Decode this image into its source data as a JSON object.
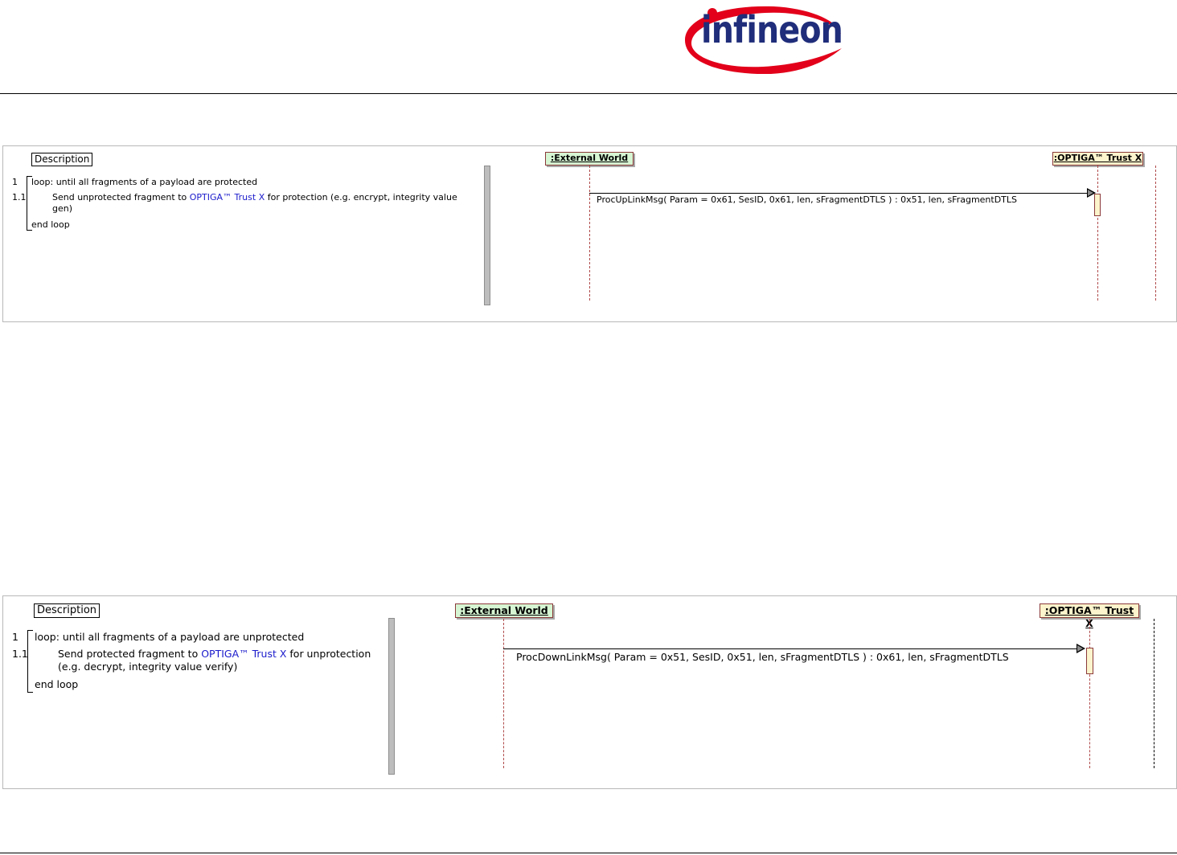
{
  "header": {
    "logo_text": "infineon",
    "brand_color": "#e2001a",
    "logo_text_color": "#1f2d7a"
  },
  "diagrams": [
    {
      "description_label": "Description",
      "steps": [
        {
          "num": "1",
          "text": "loop: until all fragments of a payload are protected"
        },
        {
          "num": "1.1",
          "text_before": "Send unprotected fragment to ",
          "highlight": "OPTIGA™ Trust X",
          "text_after": " for protection (e.g. encrypt, integrity value",
          "text_line2": "gen)"
        },
        {
          "num": "",
          "text": "end loop"
        }
      ],
      "lifelines": [
        ":External World",
        ":OPTIGA™ Trust X"
      ],
      "message": "ProcUpLinkMsg( Param = 0x61, SesID, 0x61, len, sFragmentDTLS ) : 0x51, len, sFragmentDTLS"
    },
    {
      "description_label": "Description",
      "steps": [
        {
          "num": "1",
          "text": "loop: until all fragments of a payload are unprotected"
        },
        {
          "num": "1.1",
          "text_before": "Send protected fragment to ",
          "highlight": "OPTIGA™ Trust X",
          "text_after": " for unprotection",
          "text_line2": "(e.g. decrypt, integrity value verify)"
        },
        {
          "num": "",
          "text": "end loop"
        }
      ],
      "lifelines": [
        ":External World",
        ":OPTIGA™ Trust X"
      ],
      "message": "ProcDownLinkMsg( Param = 0x51, SesID, 0x51, len, sFragmentDTLS ) : 0x61, len, sFragmentDTLS"
    }
  ]
}
